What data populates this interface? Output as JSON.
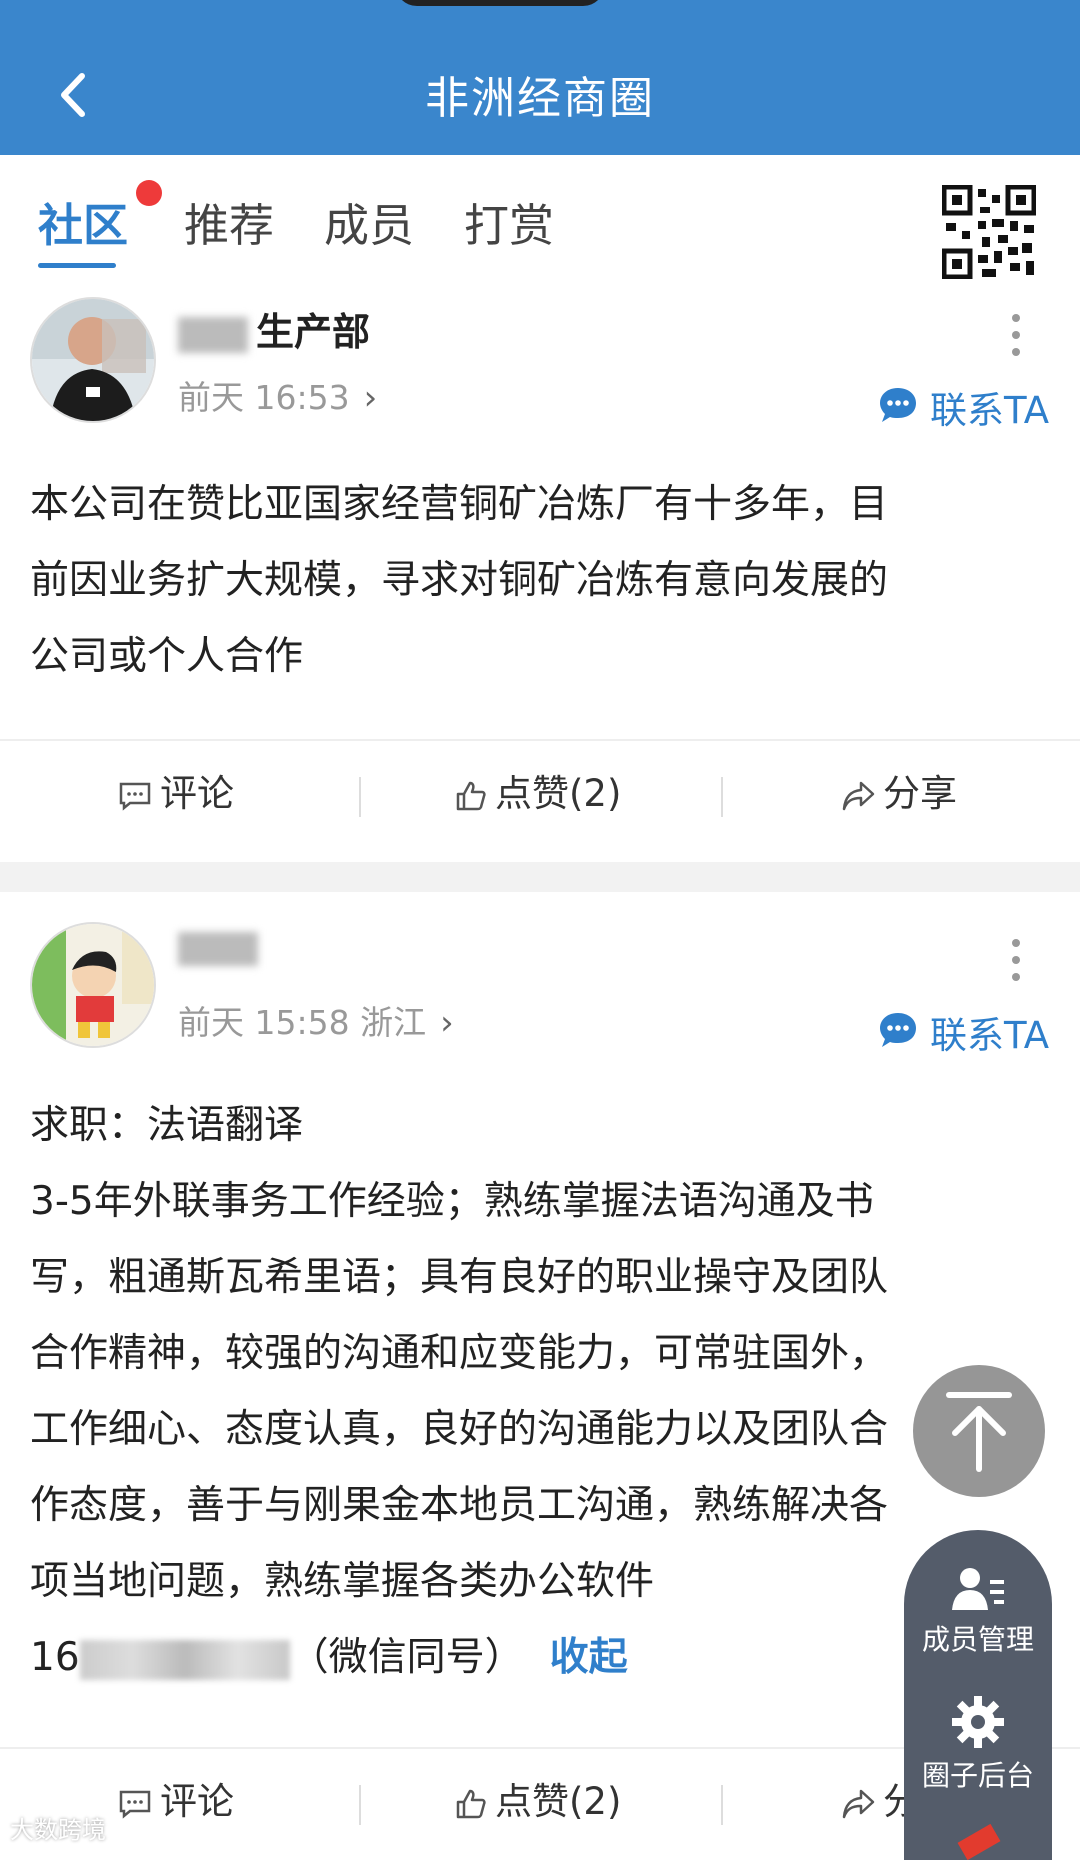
{
  "header": {
    "title": "非洲经商圈"
  },
  "tabs": [
    {
      "label": "社区",
      "active": true,
      "badge": "red-dot"
    },
    {
      "label": "推荐"
    },
    {
      "label": "成员"
    },
    {
      "label": "打赏"
    }
  ],
  "icons": {
    "back": "chevron-left-icon",
    "qr": "qr-code-icon",
    "more": "vertical-dots-icon",
    "contact": "chat-bubble-icon",
    "comment": "comment-icon",
    "like": "thumbs-up-icon",
    "share": "share-icon",
    "back_to_top": "arrow-up-icon",
    "members": "user-list-icon",
    "settings": "gear-icon"
  },
  "colors": {
    "header": "#3a86cc",
    "accent": "#2f7fcb",
    "badge": "#ee3a3a",
    "side_panel": "#545c6a"
  },
  "posts": [
    {
      "author_visible": "生产部",
      "time": "前天 16:53",
      "contact_label": "联系TA",
      "content_lines": [
        "本公司在赞比亚国家经营铜矿冶炼厂有十多年，目",
        "前因业务扩大规模，寻求对铜矿冶炼有意向发展的",
        "公司或个人合作"
      ],
      "actions": {
        "comment": "评论",
        "like": "点赞(2)",
        "share": "分享"
      }
    },
    {
      "author_visible": "",
      "time": "前天 15:58 浙江",
      "contact_label": "联系TA",
      "content_lines": [
        "求职：法语翻译",
        "3-5年外联事务工作经验；熟练掌握法语沟通及书",
        "写，粗通斯瓦希里语；具有良好的职业操守及团队",
        "合作精神，较强的沟通和应变能力，可常驻国外，",
        "工作细心、态度认真，良好的沟通能力以及团队合",
        "作态度，善于与刚果金本地员工沟通，熟练解决各",
        "项当地问题，熟练掌握各类办公软件"
      ],
      "phone_prefix": "16",
      "phone_suffix": "（微信同号）",
      "collapse_label": "收起",
      "actions": {
        "comment": "评论",
        "like": "点赞(2)",
        "share": "分享"
      }
    }
  ],
  "side_panel": {
    "members_label": "成员管理",
    "backend_label": "圈子后台"
  },
  "watermark": "大数跨境"
}
